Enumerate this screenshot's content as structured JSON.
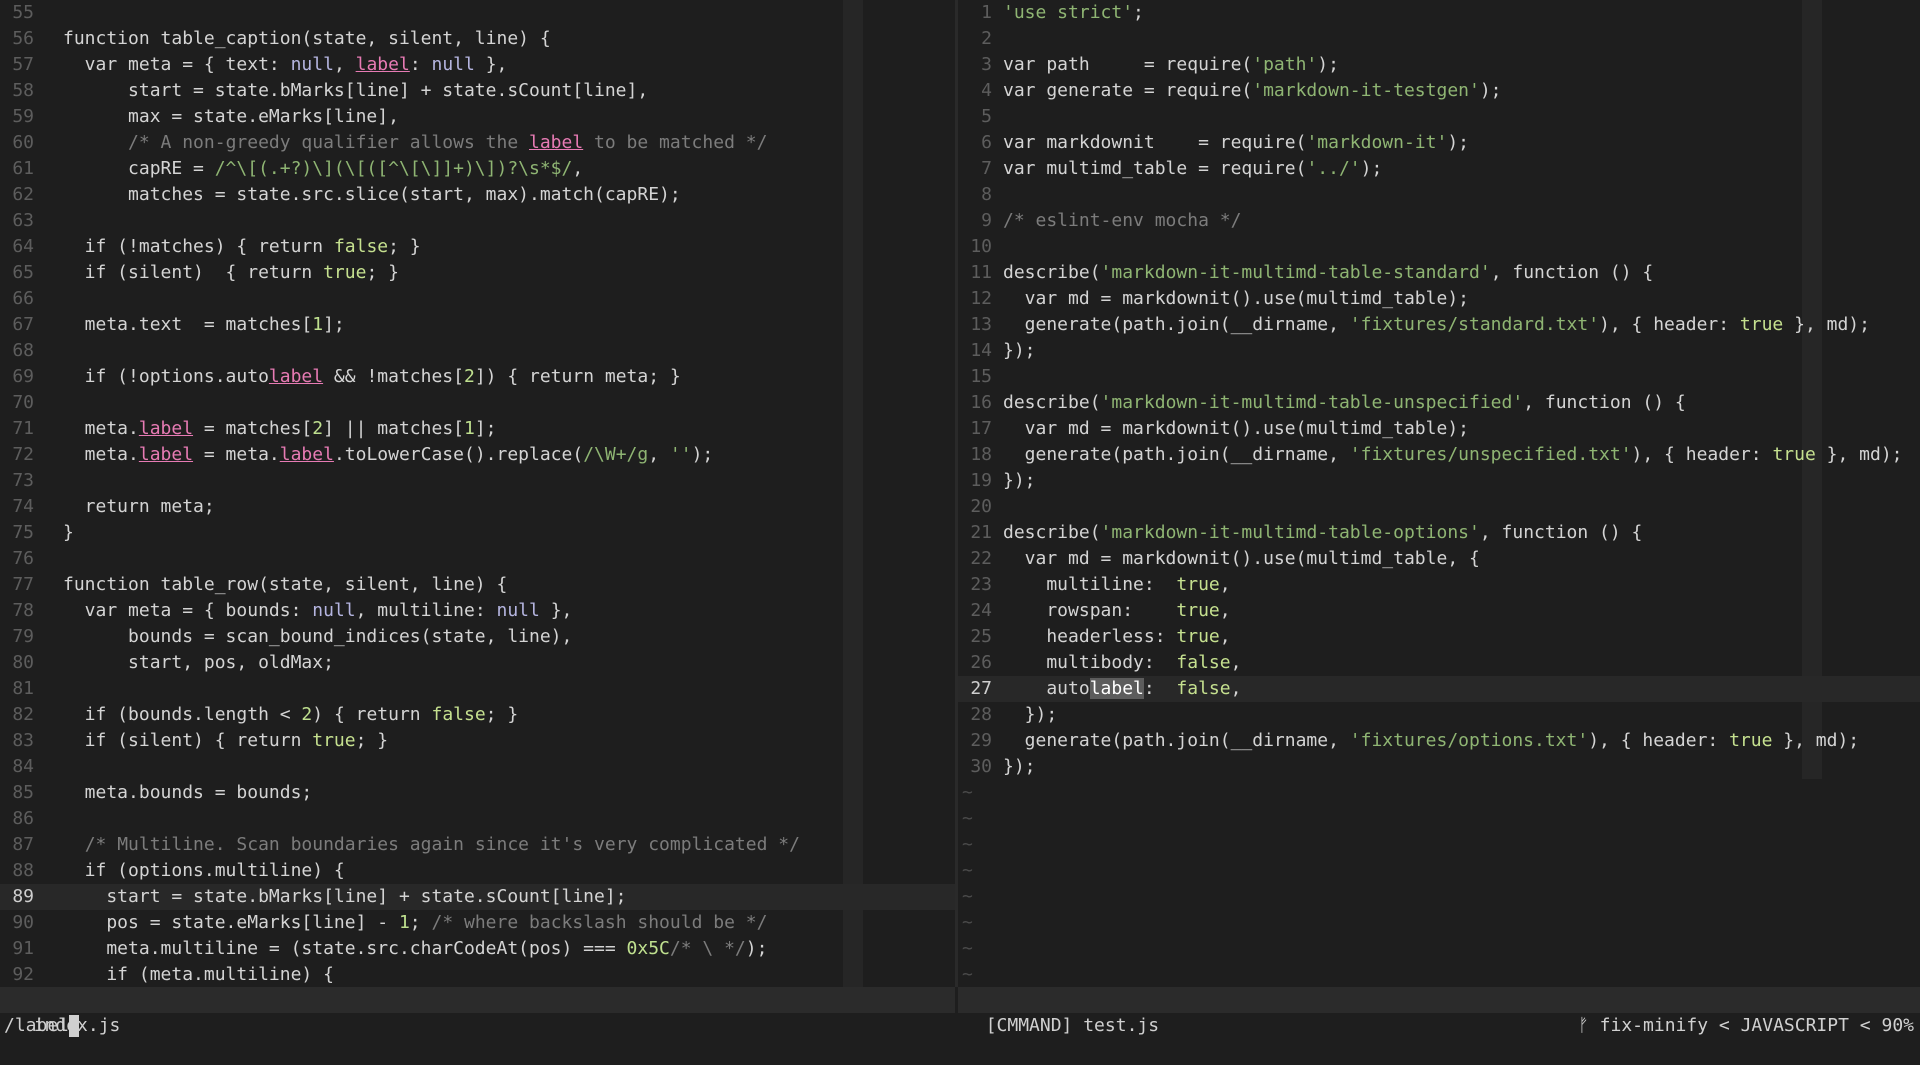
{
  "left": {
    "filename": "index.js",
    "lines": [
      {
        "n": "55",
        "t": ""
      },
      {
        "n": "56",
        "t": "function table_caption(state, silent, line) {"
      },
      {
        "n": "57",
        "t": "  var meta = { text: null, label: null },"
      },
      {
        "n": "58",
        "t": "      start = state.bMarks[line] + state.sCount[line],"
      },
      {
        "n": "59",
        "t": "      max = state.eMarks[line],"
      },
      {
        "n": "60",
        "t": "      /* A non-greedy qualifier allows the label to be matched */"
      },
      {
        "n": "61",
        "t": "      capRE = /^\\[(.+?)\\](\\[([^\\[\\]]+)\\])?\\s*$/,"
      },
      {
        "n": "62",
        "t": "      matches = state.src.slice(start, max).match(capRE);"
      },
      {
        "n": "63",
        "t": ""
      },
      {
        "n": "64",
        "t": "  if (!matches) { return false; }"
      },
      {
        "n": "65",
        "t": "  if (silent)  { return true; }"
      },
      {
        "n": "66",
        "t": ""
      },
      {
        "n": "67",
        "t": "  meta.text  = matches[1];"
      },
      {
        "n": "68",
        "t": ""
      },
      {
        "n": "69",
        "t": "  if (!options.autolabel && !matches[2]) { return meta; }"
      },
      {
        "n": "70",
        "t": ""
      },
      {
        "n": "71",
        "t": "  meta.label = matches[2] || matches[1];"
      },
      {
        "n": "72",
        "t": "  meta.label = meta.label.toLowerCase().replace(/\\W+/g, '');"
      },
      {
        "n": "73",
        "t": ""
      },
      {
        "n": "74",
        "t": "  return meta;"
      },
      {
        "n": "75",
        "t": "}"
      },
      {
        "n": "76",
        "t": ""
      },
      {
        "n": "77",
        "t": "function table_row(state, silent, line) {"
      },
      {
        "n": "78",
        "t": "  var meta = { bounds: null, multiline: null },"
      },
      {
        "n": "79",
        "t": "      bounds = scan_bound_indices(state, line),"
      },
      {
        "n": "80",
        "t": "      start, pos, oldMax;"
      },
      {
        "n": "81",
        "t": ""
      },
      {
        "n": "82",
        "t": "  if (bounds.length < 2) { return false; }"
      },
      {
        "n": "83",
        "t": "  if (silent) { return true; }"
      },
      {
        "n": "84",
        "t": ""
      },
      {
        "n": "85",
        "t": "  meta.bounds = bounds;"
      },
      {
        "n": "86",
        "t": ""
      },
      {
        "n": "87",
        "t": "  /* Multiline. Scan boundaries again since it's very complicated */"
      },
      {
        "n": "88",
        "t": "  if (options.multiline) {"
      },
      {
        "n": "89",
        "t": "    start = state.bMarks[line] + state.sCount[line];",
        "cur": true
      },
      {
        "n": "90",
        "t": "    pos = state.eMarks[line] - 1; /* where backslash should be */"
      },
      {
        "n": "91",
        "t": "    meta.multiline = (state.src.charCodeAt(pos) === 0x5C/* \\ */);"
      },
      {
        "n": "92",
        "t": "    if (meta.multiline) {"
      }
    ]
  },
  "right": {
    "filename": "[CMMAND] test.js",
    "branch": "fix-minify",
    "filetype": "JAVASCRIPT",
    "percent": "90%",
    "lines": [
      {
        "n": "1",
        "t": "'use strict';"
      },
      {
        "n": "2",
        "t": ""
      },
      {
        "n": "3",
        "t": "var path     = require('path');"
      },
      {
        "n": "4",
        "t": "var generate = require('markdown-it-testgen');"
      },
      {
        "n": "5",
        "t": ""
      },
      {
        "n": "6",
        "t": "var markdownit    = require('markdown-it');"
      },
      {
        "n": "7",
        "t": "var multimd_table = require('../');"
      },
      {
        "n": "8",
        "t": ""
      },
      {
        "n": "9",
        "t": "/* eslint-env mocha */"
      },
      {
        "n": "10",
        "t": ""
      },
      {
        "n": "11",
        "t": "describe('markdown-it-multimd-table-standard', function () {"
      },
      {
        "n": "12",
        "t": "  var md = markdownit().use(multimd_table);"
      },
      {
        "n": "13",
        "t": "  generate(path.join(__dirname, 'fixtures/standard.txt'), { header: true }, md);"
      },
      {
        "n": "14",
        "t": "});"
      },
      {
        "n": "15",
        "t": ""
      },
      {
        "n": "16",
        "t": "describe('markdown-it-multimd-table-unspecified', function () {"
      },
      {
        "n": "17",
        "t": "  var md = markdownit().use(multimd_table);"
      },
      {
        "n": "18",
        "t": "  generate(path.join(__dirname, 'fixtures/unspecified.txt'), { header: true }, md);"
      },
      {
        "n": "19",
        "t": "});"
      },
      {
        "n": "20",
        "t": ""
      },
      {
        "n": "21",
        "t": "describe('markdown-it-multimd-table-options', function () {"
      },
      {
        "n": "22",
        "t": "  var md = markdownit().use(multimd_table, {"
      },
      {
        "n": "23",
        "t": "    multiline:  true,"
      },
      {
        "n": "24",
        "t": "    rowspan:    true,"
      },
      {
        "n": "25",
        "t": "    headerless: true,"
      },
      {
        "n": "26",
        "t": "    multibody:  false,"
      },
      {
        "n": "27",
        "t": "    autolabel:  false,",
        "cur": true
      },
      {
        "n": "28",
        "t": "  });"
      },
      {
        "n": "29",
        "t": "  generate(path.join(__dirname, 'fixtures/options.txt'), { header: true }, md);"
      },
      {
        "n": "30",
        "t": "});"
      }
    ],
    "tildes": 9
  },
  "cmdline": "/label",
  "search_term": "label",
  "branch_icon": "git-branch-icon",
  "separator_icon": "chevron-left-icon"
}
